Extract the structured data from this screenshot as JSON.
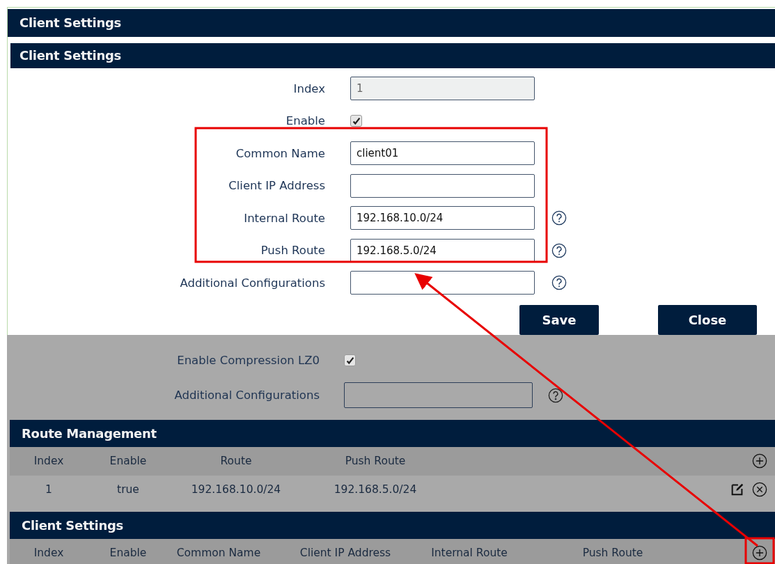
{
  "page_header": {
    "title": "Client Settings"
  },
  "dialog": {
    "title": "Client Settings",
    "fields": [
      {
        "kind": "text",
        "label": "Index",
        "value": "1",
        "disabled": true,
        "help": false
      },
      {
        "kind": "checkbox",
        "label": "Enable",
        "checked": true
      },
      {
        "kind": "text",
        "label": "Common Name",
        "value": "client01",
        "disabled": false,
        "help": false
      },
      {
        "kind": "text",
        "label": "Client IP Address",
        "disabled": false,
        "help": false
      },
      {
        "kind": "text",
        "label": "Internal Route",
        "value": "192.168.10.0/24",
        "disabled": false,
        "help": true
      },
      {
        "kind": "text",
        "label": "Push Route",
        "value": "192.168.5.0/24",
        "disabled": false,
        "help": true
      },
      {
        "kind": "text",
        "label": "Additional Configurations",
        "disabled": false,
        "help": true
      }
    ],
    "buttons": [
      "Save",
      "Close"
    ]
  },
  "background_form": {
    "fields": [
      {
        "kind": "checkbox",
        "label": "Enable Compression LZ0",
        "checked": true
      },
      {
        "kind": "text",
        "label": "Additional Configurations",
        "disabled": false,
        "help": true
      }
    ]
  },
  "route_management": {
    "title": "Route Management",
    "columns": [
      "Index",
      "Enable",
      "Route",
      "Push Route"
    ],
    "rows": [
      {
        "cells": [
          "1",
          "true",
          "192.168.10.0/24",
          "192.168.5.0/24"
        ]
      }
    ]
  },
  "client_settings": {
    "title": "Client Settings",
    "columns": [
      "Index",
      "Enable",
      "Common Name",
      "Client IP Address",
      "Internal Route",
      "Push Route"
    ]
  }
}
